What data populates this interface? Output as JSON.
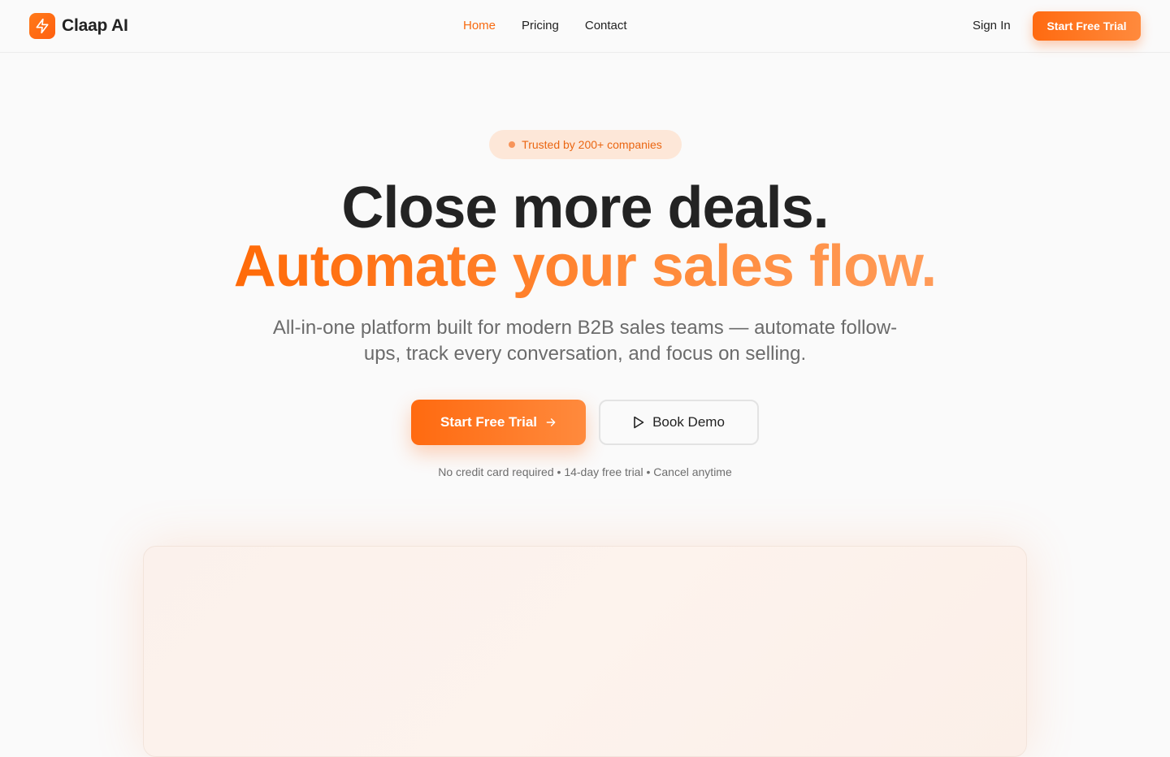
{
  "brand": {
    "name": "Claap AI",
    "logo_icon": "lightning-icon"
  },
  "nav": {
    "links": [
      {
        "label": "Home",
        "active": true
      },
      {
        "label": "Pricing",
        "active": false
      },
      {
        "label": "Contact",
        "active": false
      }
    ],
    "signin_label": "Sign In",
    "cta_label": "Start Free Trial"
  },
  "hero": {
    "badge": "Trusted by 200+ companies",
    "headline_line1": "Close more deals.",
    "headline_line2": "Automate your sales flow.",
    "subtext": "All-in-one platform built for modern B2B sales teams — automate follow-ups, track every conversation, and focus on selling.",
    "primary_cta": "Start Free Trial",
    "secondary_cta": "Book Demo",
    "note": "No credit card required • 14-day free trial • Cancel anytime"
  },
  "colors": {
    "accent": "#ff6a10",
    "accent_light": "#ff8a3d",
    "badge_bg": "#fde7d8",
    "text_dark": "#232323",
    "text_muted": "#6b6b6b"
  }
}
